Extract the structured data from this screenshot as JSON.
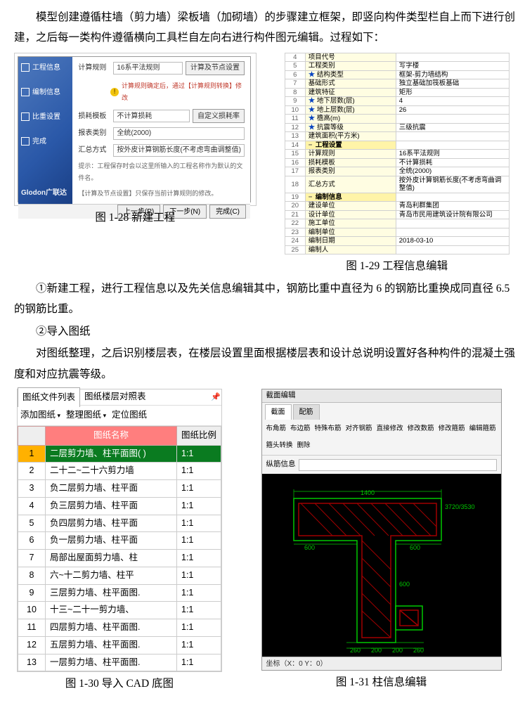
{
  "paragraphs": {
    "p1": "模型创建遵循柱墙（剪力墙）梁板墙（加砌墙）的步骤建立框架，即竖向构件类型栏自上而下进行创建，之后每一类构件遵循横向工具栏自左向右进行构件图元编辑。过程如下：",
    "p2": "①新建工程，进行工程信息以及先关信息编辑其中，钢筋比重中直径为 6 的钢筋比重换成同直径 6.5 的钢筋比重。",
    "p3": "②导入图纸",
    "p4": "对图纸整理，之后识别楼层表，在楼层设置里面根据楼层表和设计总说明设置好各种构件的混凝土强度和对应抗震等级。"
  },
  "captions": {
    "c128": "图 1-28 新建工程",
    "c129": "图 1-29 工程信息编辑",
    "c130": "图 1-30 导入 CAD 底图",
    "c131": "图 1-31 柱信息编辑"
  },
  "wizard": {
    "sideItems": [
      "工程信息",
      "编制信息",
      "比重设置",
      "完成"
    ],
    "brand": "Glodon广联达",
    "rows": {
      "ruleLbl": "计算规则",
      "ruleVal": "16系平法规则",
      "ruleBtn": "计算及节点设置",
      "warn": "计算规则确定后，通过【计算规则转换】修改",
      "tplLbl": "损耗模板",
      "tplVal": "不计算损耗",
      "tplBtn": "自定义损耗率",
      "repLbl": "报表类别",
      "repVal": "全统(2000)",
      "sumLbl": "汇总方式",
      "sumVal": "按外皮计算钢筋长度(不考虑弯曲调整值)",
      "hint1": "提示：工程保存时会以这里所输入的工程名称作为默认的文件名。",
      "hint2": "【计算及节点设置】只保存当前计算规则的修改。"
    },
    "footer": {
      "prev": "上一步(P)",
      "next": "下一步(N)",
      "done": "完成(C)"
    }
  },
  "propTable": {
    "rows": [
      {
        "i": "4",
        "k": "项目代号",
        "v": "",
        "hdr": false
      },
      {
        "i": "5",
        "k": "工程类别",
        "v": "写字楼",
        "hdr": false
      },
      {
        "i": "6",
        "k": "结构类型",
        "v": "框架-剪力墙结构",
        "hdr": false,
        "star": true
      },
      {
        "i": "7",
        "k": "基础形式",
        "v": "独立基础加筏板基础",
        "hdr": false
      },
      {
        "i": "8",
        "k": "建筑特征",
        "v": "矩形",
        "hdr": false
      },
      {
        "i": "9",
        "k": "地下层数(层)",
        "v": "4",
        "hdr": false,
        "star": true
      },
      {
        "i": "10",
        "k": "地上层数(层)",
        "v": "26",
        "hdr": false,
        "star": true
      },
      {
        "i": "11",
        "k": "檐高(m)",
        "v": "",
        "hdr": false,
        "star": true
      },
      {
        "i": "12",
        "k": "抗震等级",
        "v": "三级抗震",
        "hdr": false,
        "star": true
      },
      {
        "i": "13",
        "k": "建筑面积(平方米)",
        "v": "",
        "hdr": false
      },
      {
        "i": "14",
        "k": "工程设置",
        "v": "",
        "hdr": true,
        "minus": true
      },
      {
        "i": "15",
        "k": "计算规则",
        "v": "16系平法规则",
        "hdr": false
      },
      {
        "i": "16",
        "k": "损耗模板",
        "v": "不计算损耗",
        "hdr": false
      },
      {
        "i": "17",
        "k": "报表类别",
        "v": "全统(2000)",
        "hdr": false
      },
      {
        "i": "18",
        "k": "汇总方式",
        "v": "按外皮计算钢筋长度(不考虑弯曲调整值)",
        "hdr": false
      },
      {
        "i": "19",
        "k": "编制信息",
        "v": "",
        "hdr": true,
        "minus": true
      },
      {
        "i": "20",
        "k": "建设单位",
        "v": "青岛利群集团",
        "hdr": false
      },
      {
        "i": "21",
        "k": "设计单位",
        "v": "青岛市民用建筑设计院有限公司",
        "hdr": false
      },
      {
        "i": "22",
        "k": "施工单位",
        "v": "",
        "hdr": false
      },
      {
        "i": "23",
        "k": "编制单位",
        "v": "",
        "hdr": false
      },
      {
        "i": "24",
        "k": "编制日期",
        "v": "2018-03-10",
        "hdr": false
      },
      {
        "i": "25",
        "k": "编制人",
        "v": "",
        "hdr": false
      }
    ]
  },
  "drawingList": {
    "tab1": "图纸文件列表",
    "tab2": "图纸楼层对照表",
    "tools": {
      "add": "添加图纸",
      "sort": "整理图纸",
      "locate": "定位图纸"
    },
    "headName": "图纸名称",
    "headRatio": "图纸比例",
    "rows": [
      {
        "i": "1",
        "name": "二层剪力墙、柱平面图(  )",
        "ratio": "1:1",
        "sel": true
      },
      {
        "i": "2",
        "name": "二十二~二十六剪力墙",
        "ratio": "1:1"
      },
      {
        "i": "3",
        "name": "负二层剪力墙、柱平面",
        "ratio": "1:1"
      },
      {
        "i": "4",
        "name": "负三层剪力墙、柱平面",
        "ratio": "1:1"
      },
      {
        "i": "5",
        "name": "负四层剪力墙、柱平面",
        "ratio": "1:1"
      },
      {
        "i": "6",
        "name": "负一层剪力墙、柱平面",
        "ratio": "1:1"
      },
      {
        "i": "7",
        "name": "局部出屋面剪力墙、柱",
        "ratio": "1:1"
      },
      {
        "i": "8",
        "name": "六~十二剪力墙、柱平",
        "ratio": "1:1"
      },
      {
        "i": "9",
        "name": "三层剪力墙、柱平面图.",
        "ratio": "1:1"
      },
      {
        "i": "10",
        "name": "十三~二十一剪力墙、",
        "ratio": "1:1"
      },
      {
        "i": "11",
        "name": "四层剪力墙、柱平面图.",
        "ratio": "1:1"
      },
      {
        "i": "12",
        "name": "五层剪力墙、柱平面图.",
        "ratio": "1:1"
      },
      {
        "i": "13",
        "name": "一层剪力墙、柱平面图.",
        "ratio": "1:1"
      }
    ]
  },
  "cad": {
    "title": "截面编辑",
    "tabs": {
      "t1": "截面",
      "t2": "配筋"
    },
    "tools": [
      "布角筋",
      "布边筋",
      "特殊布筋",
      "对齐钢筋",
      "直接修改",
      "修改数筋",
      "修改箍筋",
      "编辑箍筋",
      "箍头转换",
      "删除"
    ],
    "infoLabel": "纵筋信息",
    "status": "坐标（X：0 Y：0）",
    "dims": {
      "top": "1400",
      "left": "600",
      "right": "600",
      "rvert": "600",
      "bot1": "260",
      "bot2": "200",
      "bot3": "200",
      "bot4": "260",
      "far": "3720/3530"
    }
  }
}
